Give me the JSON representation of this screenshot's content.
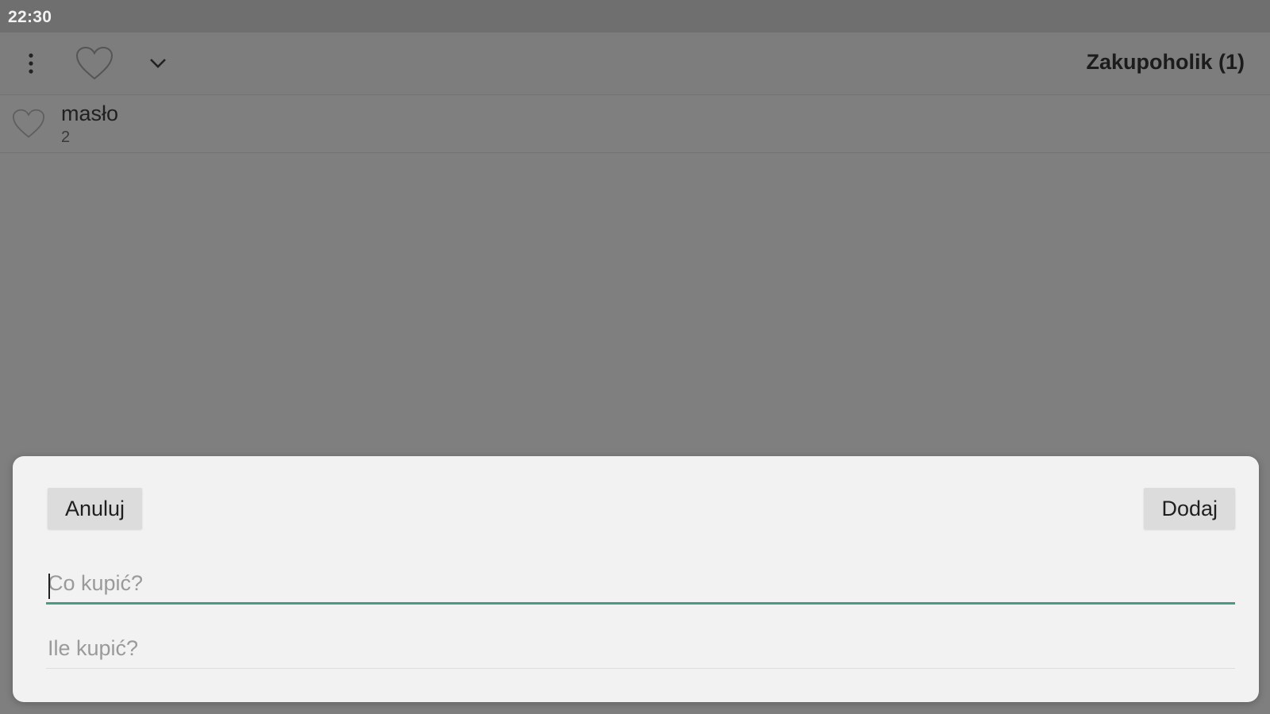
{
  "status_bar": {
    "time": "22:30"
  },
  "app_bar": {
    "title": "Zakupoholik (1)",
    "icons": [
      "more-vert-icon",
      "heart-outline-icon",
      "chevron-down-icon"
    ]
  },
  "list": {
    "items": [
      {
        "name": "masło",
        "quantity": "2",
        "icon": "heart-outline-icon"
      }
    ]
  },
  "dialog": {
    "cancel_label": "Anuluj",
    "add_label": "Dodaj",
    "what_field": {
      "placeholder": "Co kupić?",
      "value": ""
    },
    "how_many_field": {
      "placeholder": "Ile kupić?",
      "value": ""
    }
  },
  "colors": {
    "scrim": "#7f7f7f",
    "status_bar": "#6f6f6f",
    "sheet": "#f2f2f2",
    "accent": "#4a9a88",
    "button": "#dcdcdc"
  }
}
